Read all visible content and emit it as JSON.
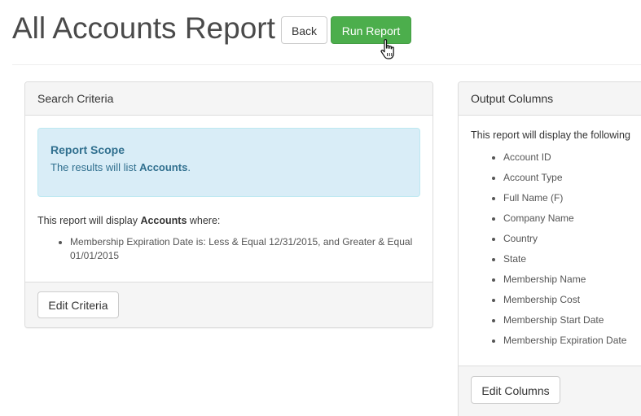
{
  "header": {
    "title": "All Accounts Report",
    "back_label": "Back",
    "run_label": "Run Report"
  },
  "criteria_panel": {
    "heading": "Search Criteria",
    "scope_title": "Report Scope",
    "scope_prefix": "The results will list ",
    "scope_entity": "Accounts",
    "scope_suffix": ".",
    "lead_prefix": "This report will display ",
    "lead_entity": "Accounts",
    "lead_suffix": " where:",
    "criteria": [
      "Membership Expiration Date is: Less & Equal 12/31/2015, and Greater & Equal 01/01/2015"
    ],
    "edit_label": "Edit Criteria"
  },
  "columns_panel": {
    "heading": "Output Columns",
    "lead": "This report will display the following",
    "columns": [
      "Account ID",
      "Account Type",
      "Full Name (F)",
      "Company Name",
      "Country",
      "State",
      "Membership Name",
      "Membership Cost",
      "Membership Start Date",
      "Membership Expiration Date"
    ],
    "edit_label": "Edit Columns"
  },
  "colors": {
    "primary_action": "#4cae4c",
    "info_background": "#d9edf7",
    "info_text": "#31708f"
  },
  "icons": {
    "cursor": "hand-pointer-icon"
  }
}
